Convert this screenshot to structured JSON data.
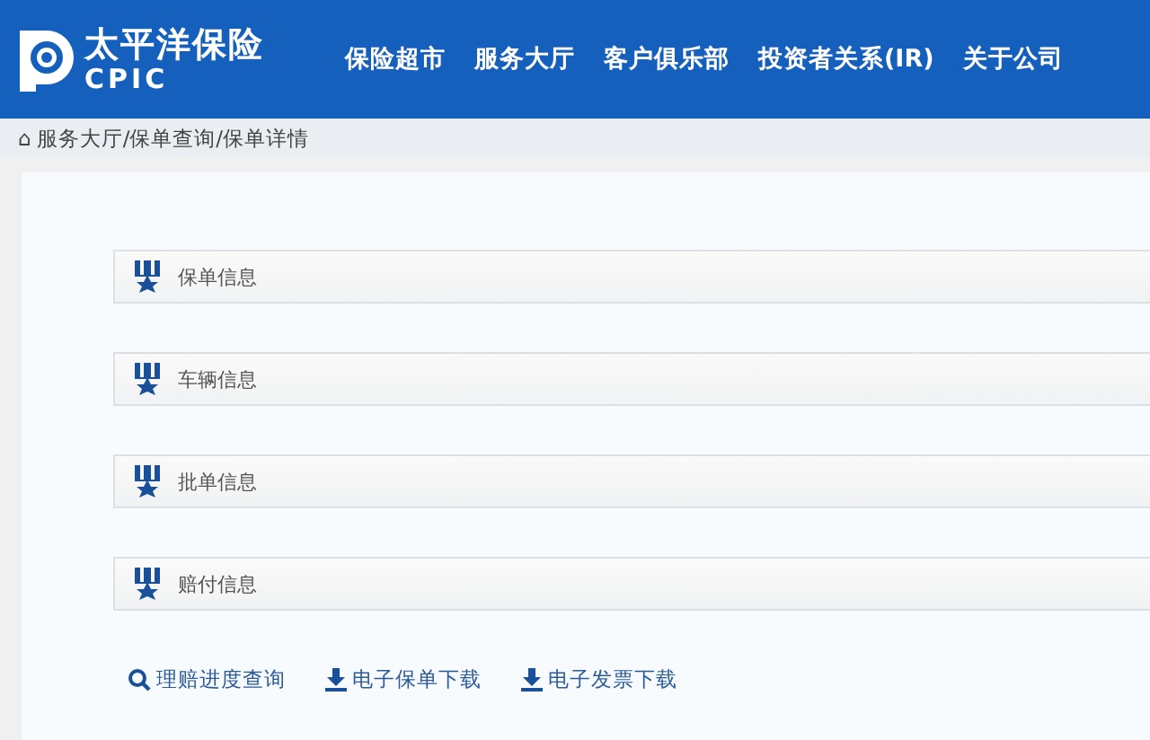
{
  "header": {
    "logo": {
      "name": "太平洋保险",
      "sub": "CPIC"
    },
    "nav": [
      "保险超市",
      "服务大厅",
      "客户俱乐部",
      "投资者关系(IR)",
      "关于公司"
    ]
  },
  "breadcrumb": {
    "icon": "⌂",
    "path": "服务大厅/保单查询/保单详情"
  },
  "sections": [
    "保单信息",
    "车辆信息",
    "批单信息",
    "赔付信息"
  ],
  "actions": [
    {
      "kind": "search",
      "label": "理赔进度查询"
    },
    {
      "kind": "download",
      "label": "电子保单下载"
    },
    {
      "kind": "download",
      "label": "电子发票下载"
    }
  ]
}
